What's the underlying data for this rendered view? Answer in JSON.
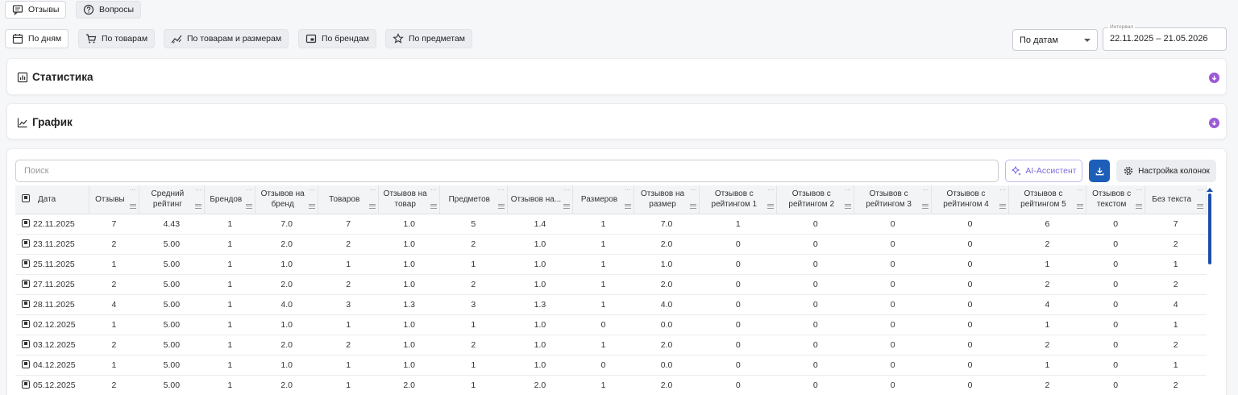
{
  "top_tabs": [
    {
      "label": "Отзывы",
      "icon": "chat-icon"
    },
    {
      "label": "Вопросы",
      "icon": "question-icon"
    }
  ],
  "view_tabs": [
    {
      "label": "По дням",
      "icon": "calendar-icon"
    },
    {
      "label": "По товарам",
      "icon": "cart-icon"
    },
    {
      "label": "По товарам и размерам",
      "icon": "ruler-icon"
    },
    {
      "label": "По брендам",
      "icon": "brand-icon"
    },
    {
      "label": "По предметам",
      "icon": "star-icon"
    }
  ],
  "filter": {
    "mode_value": "По датам",
    "interval_label": "Интервал",
    "interval_value": "22.11.2025 – 21.05.2026"
  },
  "panels": {
    "stats_title": "Статистика",
    "chart_title": "График"
  },
  "toolbar": {
    "search_placeholder": "Поиск",
    "ai_label": "AI-Ассистент",
    "columns_label": "Настройка колонок"
  },
  "table": {
    "headers": [
      "Дата",
      "Отзывы",
      "Средний рейтинг",
      "Брендов",
      "Отзывов на бренд",
      "Товаров",
      "Отзывов на товар",
      "Предметов",
      "Отзывов на...",
      "Размеров",
      "Отзывов на размер",
      "Отзывов с рейтингом 1",
      "Отзывов с рейтингом 2",
      "Отзывов с рейтингом 3",
      "Отзывов с рейтингом 4",
      "Отзывов с рейтингом 5",
      "Отзывов с текстом",
      "Без текста"
    ],
    "rows": [
      [
        "22.11.2025",
        "7",
        "4.43",
        "1",
        "7.0",
        "7",
        "1.0",
        "5",
        "1.4",
        "1",
        "7.0",
        "1",
        "0",
        "0",
        "0",
        "6",
        "0",
        "7"
      ],
      [
        "23.11.2025",
        "2",
        "5.00",
        "1",
        "2.0",
        "2",
        "1.0",
        "2",
        "1.0",
        "1",
        "2.0",
        "0",
        "0",
        "0",
        "0",
        "2",
        "0",
        "2"
      ],
      [
        "25.11.2025",
        "1",
        "5.00",
        "1",
        "1.0",
        "1",
        "1.0",
        "1",
        "1.0",
        "1",
        "1.0",
        "0",
        "0",
        "0",
        "0",
        "1",
        "0",
        "1"
      ],
      [
        "27.11.2025",
        "2",
        "5.00",
        "1",
        "2.0",
        "2",
        "1.0",
        "2",
        "1.0",
        "1",
        "2.0",
        "0",
        "0",
        "0",
        "0",
        "2",
        "0",
        "2"
      ],
      [
        "28.11.2025",
        "4",
        "5.00",
        "1",
        "4.0",
        "3",
        "1.3",
        "3",
        "1.3",
        "1",
        "4.0",
        "0",
        "0",
        "0",
        "0",
        "4",
        "0",
        "4"
      ],
      [
        "02.12.2025",
        "1",
        "5.00",
        "1",
        "1.0",
        "1",
        "1.0",
        "1",
        "1.0",
        "0",
        "0.0",
        "0",
        "0",
        "0",
        "0",
        "1",
        "0",
        "1"
      ],
      [
        "03.12.2025",
        "2",
        "5.00",
        "1",
        "2.0",
        "2",
        "1.0",
        "2",
        "1.0",
        "1",
        "2.0",
        "0",
        "0",
        "0",
        "0",
        "2",
        "0",
        "2"
      ],
      [
        "04.12.2025",
        "1",
        "5.00",
        "1",
        "1.0",
        "1",
        "1.0",
        "1",
        "1.0",
        "0",
        "0.0",
        "0",
        "0",
        "0",
        "0",
        "1",
        "0",
        "1"
      ],
      [
        "05.12.2025",
        "2",
        "5.00",
        "1",
        "2.0",
        "1",
        "2.0",
        "1",
        "2.0",
        "1",
        "2.0",
        "0",
        "0",
        "0",
        "0",
        "2",
        "0",
        "2"
      ]
    ]
  }
}
